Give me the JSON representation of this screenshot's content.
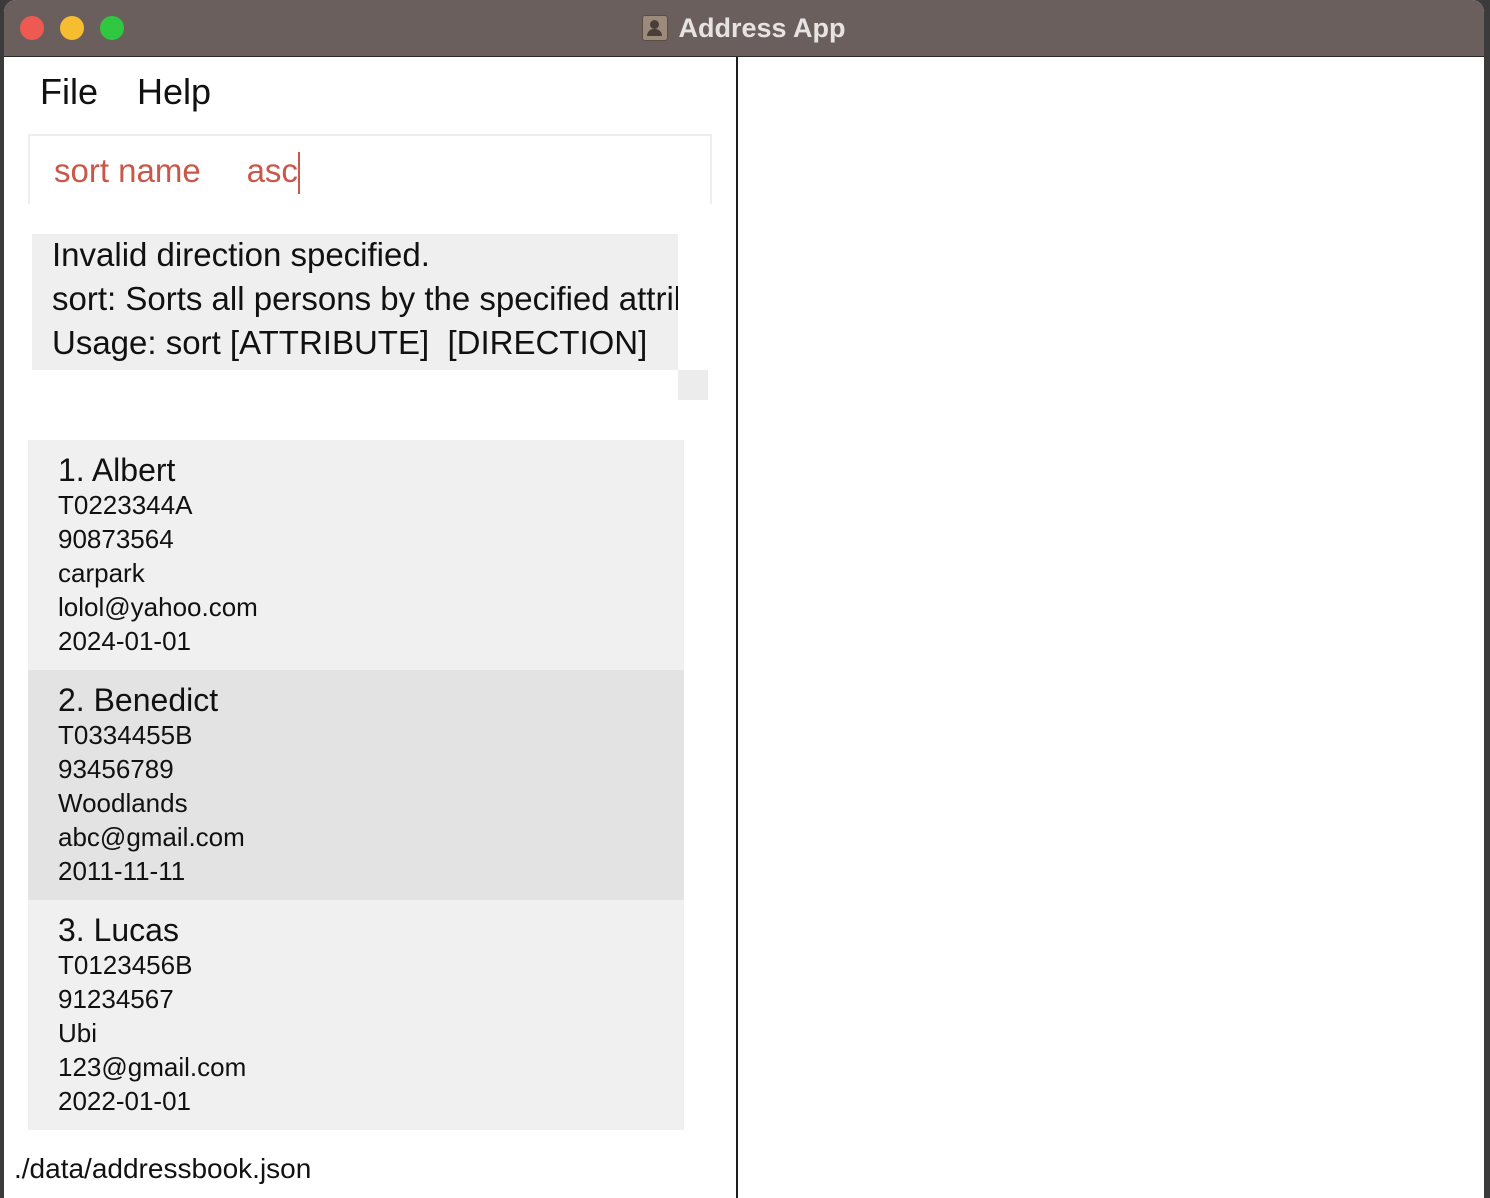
{
  "window": {
    "title": "Address App"
  },
  "menu": {
    "file": "File",
    "help": "Help"
  },
  "command": {
    "value": "sort name     asc"
  },
  "result": {
    "lines": [
      "Invalid direction specified.",
      "sort: Sorts all persons by the specified attrib",
      "Usage: sort [ATTRIBUTE]  [DIRECTION]"
    ]
  },
  "persons": [
    {
      "name": "1. Albert",
      "nric": "T0223344A",
      "phone": "90873564",
      "address": "carpark",
      "email": "lolol@yahoo.com",
      "date": "2024-01-01"
    },
    {
      "name": "2. Benedict",
      "nric": "T0334455B",
      "phone": "93456789",
      "address": "Woodlands",
      "email": "abc@gmail.com",
      "date": "2011-11-11"
    },
    {
      "name": "3. Lucas",
      "nric": "T0123456B",
      "phone": "91234567",
      "address": "Ubi",
      "email": "123@gmail.com",
      "date": "2022-01-01"
    }
  ],
  "status": {
    "path": "./data/addressbook.json"
  },
  "colors": {
    "titlebar": "#6b5f5d",
    "command_text": "#c9584a",
    "card_odd": "#f0f0f0",
    "card_even": "#e3e3e3"
  }
}
